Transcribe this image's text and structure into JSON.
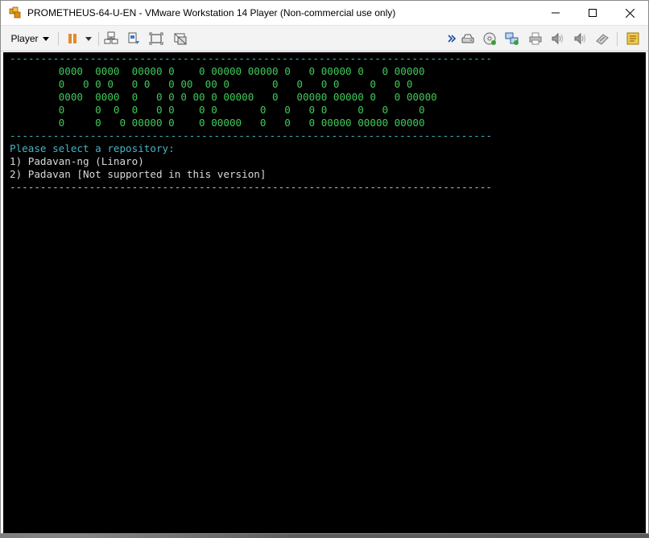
{
  "window": {
    "title": "PROMETHEUS-64-U-EN - VMware Workstation 14 Player (Non-commercial use only)"
  },
  "toolbar": {
    "player_label": "Player"
  },
  "colors": {
    "banner": "#3fc95a",
    "prompt": "#42b6c4",
    "pause": "#e58a2c"
  },
  "console": {
    "divider": "------------------------------------------------------------------------------",
    "banner": [
      "0000  0000  00000 0    0 00000 00000 0   0 00000 0   0 00000",
      "0   0 0 0   0 0   0 00  00 0       0   0   0 0     0   0 0",
      "0000  0000  0   0 0 0 00 0 00000   0   00000 00000 0   0 00000",
      "0     0  0  0   0 0    0 0       0   0   0 0     0   0     0",
      "0     0   0 00000 0    0 00000   0   0   0 00000 00000 00000"
    ],
    "banner_indent": "        ",
    "prompt": "Please select a repository:",
    "options": [
      "1) Padavan-ng (Linaro)",
      "2) Padavan [Not supported in this version]"
    ],
    "divider_bottom": "-------------------------------------------------------------------------------"
  }
}
